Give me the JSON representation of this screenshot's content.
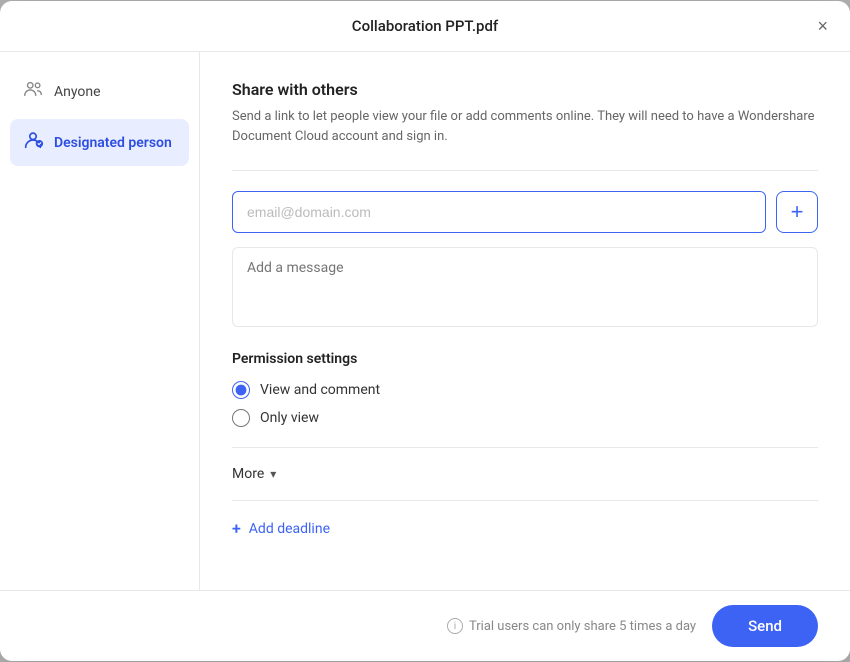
{
  "modal": {
    "title": "Collaboration PPT.pdf",
    "close_label": "×"
  },
  "sidebar": {
    "items": [
      {
        "id": "anyone",
        "label": "Anyone",
        "active": false
      },
      {
        "id": "designated-person",
        "label": "Designated person",
        "active": true
      }
    ]
  },
  "main": {
    "share_title": "Share with others",
    "share_desc": "Send a link to let people view your file or add comments online. They will need to have a Wondershare Document Cloud account and sign in.",
    "email_placeholder": "email@domain.com",
    "add_button_label": "+",
    "message_placeholder": "Add a message",
    "permission_title": "Permission settings",
    "permissions": [
      {
        "id": "view-comment",
        "label": "View and comment",
        "checked": true
      },
      {
        "id": "only-view",
        "label": "Only view",
        "checked": false
      }
    ],
    "more_label": "More",
    "add_deadline_label": "Add deadline"
  },
  "footer": {
    "trial_notice": "Trial users can only share 5 times a day",
    "send_label": "Send"
  },
  "icons": {
    "anyone": "👥",
    "designated": "👤",
    "info": "i",
    "chevron_down": "▾",
    "plus": "+"
  }
}
